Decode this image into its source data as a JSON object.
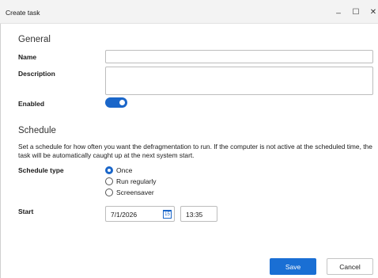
{
  "window": {
    "title": "Create task",
    "minimize_glyph": "_",
    "maximize_glyph": "☐",
    "close_glyph": "✕"
  },
  "general": {
    "heading": "General",
    "name_label": "Name",
    "name_value": "",
    "description_label": "Description",
    "description_value": "",
    "enabled_label": "Enabled",
    "enabled": true
  },
  "schedule": {
    "heading": "Schedule",
    "description": "Set a schedule for how often you want the defragmentation to run. If the computer is not active at the scheduled time, the task will be automatically caught up at the next system start.",
    "type_label": "Schedule type",
    "options": [
      "Once",
      "Run regularly",
      "Screensaver"
    ],
    "selected": "Once",
    "start_label": "Start",
    "start_date": "7/1/2026",
    "calendar_icon_text": "15",
    "start_time": "13:35"
  },
  "buttons": {
    "save": "Save",
    "cancel": "Cancel"
  },
  "colors": {
    "accent": "#1a66c9",
    "save_button": "#1a6fd4"
  }
}
